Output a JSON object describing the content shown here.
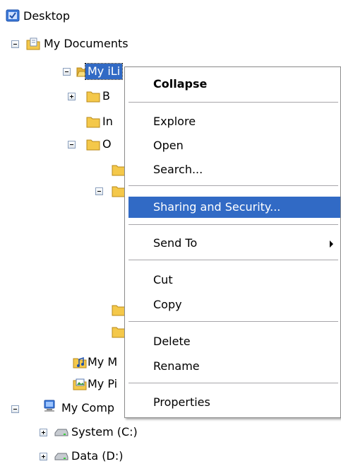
{
  "tree": {
    "desktop": "Desktop",
    "my_documents": "My Documents",
    "my_ilink": "My iLi",
    "b_folder": "B",
    "in_folder": "In",
    "o_folder": "O",
    "my_music": "My M",
    "my_pictures": "My Pi",
    "my_computer": "My Comp",
    "system_c": "System (C:)",
    "data_d": "Data (D:)"
  },
  "context_menu": {
    "collapse": "Collapse",
    "explore": "Explore",
    "open": "Open",
    "search": "Search...",
    "sharing": "Sharing and Security...",
    "send_to": "Send To",
    "cut": "Cut",
    "copy": "Copy",
    "delete": "Delete",
    "rename": "Rename",
    "properties": "Properties"
  },
  "colors": {
    "selection": "#316ac5",
    "folder": "#f4c84a",
    "menu_border": "#8c8c8c"
  }
}
